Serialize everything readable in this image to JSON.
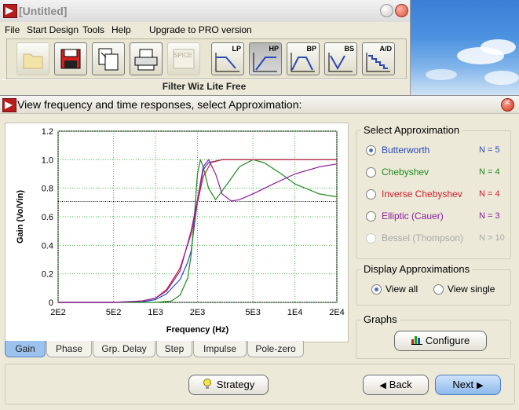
{
  "main_window": {
    "title": "[Untitled]",
    "menu": [
      "File",
      "Start Design",
      "Tools",
      "Help",
      "Upgrade to PRO version"
    ],
    "toolbar": {
      "spice_label": "SPICE",
      "lp_label": "LP",
      "hp_label": "HP",
      "bp_label": "BP",
      "bs_label": "BS",
      "ad_label": "A/D"
    },
    "status_text": "Filter Wiz Lite Free"
  },
  "dialog": {
    "title": "View frequency and time responses, select Approximation:",
    "approximations": {
      "title": "Select Approximation",
      "items": [
        {
          "label": "Butterworth",
          "order": "N = 5",
          "color": "#2a49b8",
          "selected": true
        },
        {
          "label": "Chebyshev",
          "order": "N = 4",
          "color": "#1f8a1f",
          "selected": false
        },
        {
          "label": "Inverse Chebyshev",
          "order": "N = 4",
          "color": "#cc1e2c",
          "selected": false
        },
        {
          "label": "Elliptic  (Cauer)",
          "order": "N = 3",
          "color": "#8a1e9c",
          "selected": false
        },
        {
          "label": "Bessel (Thompson)",
          "order": "N > 10",
          "color": "#a8a8a8",
          "selected": false
        }
      ]
    },
    "display": {
      "title": "Display Approximations",
      "view_all": "View all",
      "view_single": "View single",
      "selected": "view_all"
    },
    "graphs": {
      "title": "Graphs",
      "configure": "Configure"
    },
    "tabs": [
      "Gain",
      "Phase",
      "Grp. Delay",
      "Step",
      "Impulse",
      "Pole-zero"
    ],
    "active_tab": "Gain",
    "buttons": {
      "strategy": "Strategy",
      "back": "Back",
      "next": "Next"
    }
  },
  "chart_data": {
    "type": "line",
    "xlabel": "Frequency  (Hz)",
    "ylabel": "Gain  (Vo/Vin)",
    "x_scale": "log",
    "xlim": [
      200,
      20000
    ],
    "ylim": [
      0,
      1.2
    ],
    "x_ticks": [
      "2E2",
      "5E2",
      "1E3",
      "2E3",
      "5E3",
      "1E4",
      "2E4"
    ],
    "y_ticks": [
      "0",
      "0.2",
      "0.4",
      "0.6",
      "0.8",
      "1.0",
      "1.2"
    ],
    "grid": true,
    "reference_line_y": 0.707,
    "series": [
      {
        "name": "Butterworth",
        "color": "#2a49b8",
        "x": [
          200,
          500,
          800,
          1000,
          1200,
          1500,
          1700,
          1800,
          2000,
          2200,
          2400,
          3000,
          5000,
          20000
        ],
        "y": [
          0,
          0,
          0.003,
          0.02,
          0.06,
          0.16,
          0.28,
          0.36,
          0.71,
          0.93,
          0.98,
          1.0,
          1.0,
          1.0
        ]
      },
      {
        "name": "Chebyshev",
        "color": "#1f8a1f",
        "x": [
          200,
          500,
          1000,
          1300,
          1500,
          1700,
          1800,
          1900,
          2000,
          2100,
          2200,
          2400,
          2700,
          3000,
          3500,
          4000,
          5000,
          6000,
          8000,
          10000,
          15000,
          20000
        ],
        "y": [
          0,
          0,
          0,
          0.01,
          0.05,
          0.17,
          0.33,
          0.6,
          0.9,
          1.0,
          0.95,
          0.8,
          0.72,
          0.78,
          0.87,
          0.95,
          1.0,
          0.98,
          0.9,
          0.83,
          0.76,
          0.74
        ]
      },
      {
        "name": "Inverse Chebyshev",
        "color": "#cc1e2c",
        "x": [
          200,
          500,
          800,
          1000,
          1200,
          1500,
          1800,
          2000,
          2200,
          2500,
          3000,
          20000
        ],
        "y": [
          0,
          0,
          0.01,
          0.03,
          0.09,
          0.24,
          0.48,
          0.7,
          0.88,
          0.98,
          1.0,
          1.0
        ]
      },
      {
        "name": "Elliptic (Cauer)",
        "color": "#8a1e9c",
        "x": [
          200,
          500,
          800,
          1000,
          1200,
          1500,
          1800,
          2000,
          2200,
          2400,
          2700,
          3000,
          3500,
          4000,
          5000,
          7000,
          10000,
          15000,
          20000
        ],
        "y": [
          0,
          0,
          0.01,
          0.03,
          0.08,
          0.22,
          0.5,
          0.72,
          0.95,
          1.0,
          0.9,
          0.76,
          0.71,
          0.72,
          0.76,
          0.83,
          0.9,
          0.95,
          0.97
        ]
      }
    ]
  }
}
